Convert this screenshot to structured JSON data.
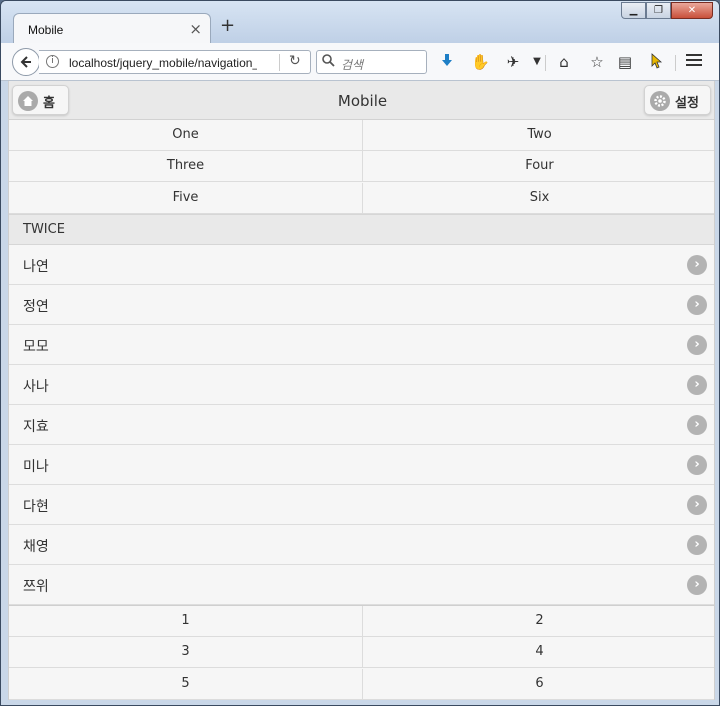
{
  "browser": {
    "tab_title": "Mobile",
    "tab_close": "×",
    "new_tab": "+",
    "window_buttons": [
      "▁",
      "❐",
      "✕"
    ],
    "url": "localhost/jquery_mobile/navigation_b",
    "search_placeholder": "검색"
  },
  "header": {
    "title": "Mobile",
    "home_label": "홈",
    "settings_label": "설정"
  },
  "nav_top": {
    "rows": [
      [
        "One",
        "Two"
      ],
      [
        "Three",
        "Four"
      ],
      [
        "Five",
        "Six"
      ]
    ]
  },
  "list": {
    "divider": "TWICE",
    "items": [
      "나연",
      "정연",
      "모모",
      "사나",
      "지효",
      "미나",
      "다현",
      "채영",
      "쯔위"
    ]
  },
  "nav_bottom": {
    "rows": [
      [
        "1",
        "2"
      ],
      [
        "3",
        "4"
      ],
      [
        "5",
        "6"
      ]
    ]
  },
  "colors": {
    "header_bg": "#e9e9e9",
    "page_bg": "#f6f6f6",
    "icon_gray": "#b3b3b3"
  }
}
